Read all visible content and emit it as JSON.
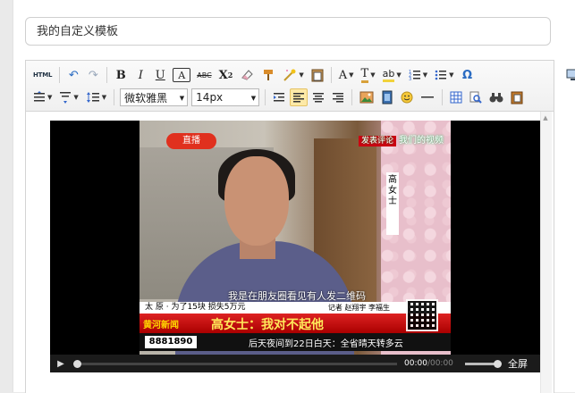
{
  "title_input": {
    "value": "我的自定义模板"
  },
  "toolbar": {
    "html_label": "HTML",
    "bold": "B",
    "italic": "I",
    "underline": "U",
    "boxed_a": "A",
    "strike": "ABC",
    "superscript_base": "X",
    "superscript_exp": "2",
    "font_color": "A",
    "font_bg": "T",
    "spell": "ab",
    "special_char": "Ω",
    "font_family": "微软雅黑",
    "font_size": "14px"
  },
  "video": {
    "station_badge": "直播",
    "program_tag": "发表评论",
    "watermark": "我们的视频",
    "vertical_name": "高女士",
    "subtitle": "我是在朋友圈看见有人发二维码",
    "bar_place": "太  原 · 为了15块  损失5万元",
    "bar_reporter": "记者  赵翔宇  李福生",
    "brand": "黄河新闻",
    "headline": "高女士：我对不起他",
    "hotline": "8881890",
    "ticker": "后天夜间到22日白天：全省晴天转多云",
    "time_current": "00:00",
    "time_total": "/00:00",
    "fullscreen": "全屏"
  }
}
